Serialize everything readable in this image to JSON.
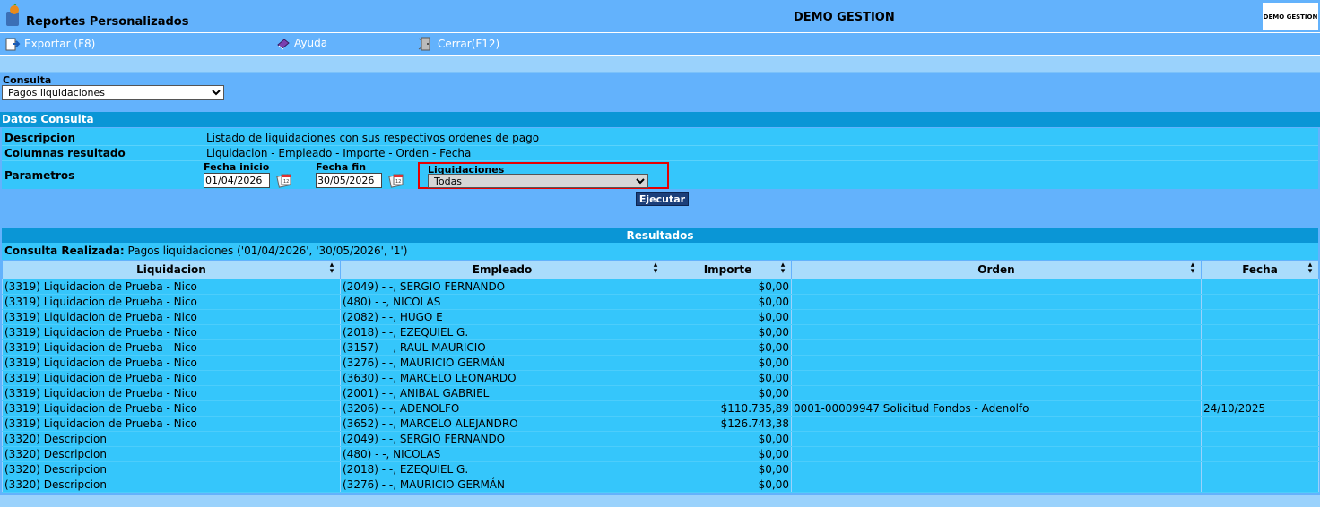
{
  "header": {
    "app_title": "Reportes Personalizados",
    "company": "DEMO GESTION",
    "brand_box": "DEMO GESTION"
  },
  "toolbar": {
    "export_label": "Exportar (F8)",
    "help_label": "Ayuda",
    "close_label": "Cerrar(F12)"
  },
  "consulta": {
    "label": "Consulta",
    "selected": "Pagos liquidaciones"
  },
  "datos": {
    "section_title": "Datos Consulta",
    "descripcion_label": "Descripcion",
    "descripcion_value": "Listado de liquidaciones con sus respectivos ordenes de pago",
    "columnas_label": "Columnas resultado",
    "columnas_value": "Liquidacion - Empleado - Importe - Orden - Fecha",
    "parametros_label": "Parametros",
    "fecha_inicio_label": "Fecha inicio",
    "fecha_inicio_value": "01/04/2026",
    "fecha_fin_label": "Fecha fin",
    "fecha_fin_value": "30/05/2026",
    "liquidaciones_label": "Liquidaciones",
    "liquidaciones_selected": "Todas",
    "ejecutar_label": "Ejecutar"
  },
  "results": {
    "title": "Resultados",
    "consulta_realizada_label": "Consulta Realizada:",
    "consulta_realizada_value": "Pagos liquidaciones ('01/04/2026', '30/05/2026', '1')",
    "columns": [
      "Liquidacion",
      "Empleado",
      "Importe",
      "Orden",
      "Fecha"
    ],
    "rows": [
      [
        "(3319) Liquidacion de Prueba - Nico",
        "(2049) - -, SERGIO FERNANDO",
        "$0,00",
        "",
        ""
      ],
      [
        "(3319) Liquidacion de Prueba - Nico",
        "(480) - -, NICOLAS",
        "$0,00",
        "",
        ""
      ],
      [
        "(3319) Liquidacion de Prueba - Nico",
        "(2082) - -, HUGO E",
        "$0,00",
        "",
        ""
      ],
      [
        "(3319) Liquidacion de Prueba - Nico",
        "(2018) - -, EZEQUIEL G.",
        "$0,00",
        "",
        ""
      ],
      [
        "(3319) Liquidacion de Prueba - Nico",
        "(3157) - -, RAUL MAURICIO",
        "$0,00",
        "",
        ""
      ],
      [
        "(3319) Liquidacion de Prueba - Nico",
        "(3276) - -, MAURICIO GERMÁN",
        "$0,00",
        "",
        ""
      ],
      [
        "(3319) Liquidacion de Prueba - Nico",
        "(3630) - -, MARCELO LEONARDO",
        "$0,00",
        "",
        ""
      ],
      [
        "(3319) Liquidacion de Prueba - Nico",
        "(2001) - -, ANIBAL GABRIEL",
        "$0,00",
        "",
        ""
      ],
      [
        "(3319) Liquidacion de Prueba - Nico",
        "(3206) - -, ADENOLFO",
        "$110.735,89",
        "0001-00009947 Solicitud Fondos - Adenolfo",
        "24/10/2025"
      ],
      [
        "(3319) Liquidacion de Prueba - Nico",
        "(3652) - -, MARCELO ALEJANDRO",
        "$126.743,38",
        "",
        ""
      ],
      [
        "(3320) Descripcion",
        "(2049) - -, SERGIO FERNANDO",
        "$0,00",
        "",
        ""
      ],
      [
        "(3320) Descripcion",
        "(480) - -, NICOLAS",
        "$0,00",
        "",
        ""
      ],
      [
        "(3320) Descripcion",
        "(2018) - -, EZEQUIEL G.",
        "$0,00",
        "",
        ""
      ],
      [
        "(3320) Descripcion",
        "(3276) - -, MAURICIO GERMÁN",
        "$0,00",
        "",
        ""
      ]
    ]
  }
}
